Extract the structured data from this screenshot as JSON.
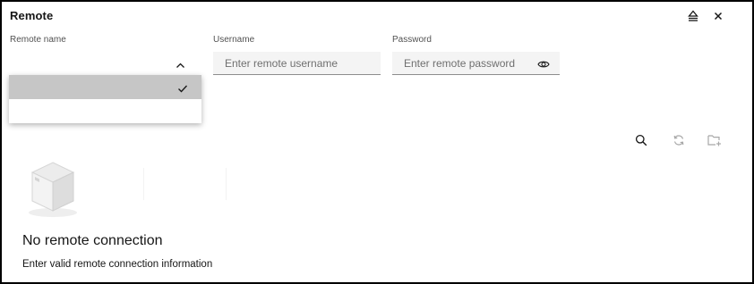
{
  "window": {
    "title": "Remote"
  },
  "header_icons": {
    "left": "eject-icon",
    "right": "close-icon"
  },
  "form": {
    "remote_name": {
      "label": "Remote name",
      "value": "",
      "options": [
        "",
        ""
      ],
      "selected_index": 0
    },
    "username": {
      "label": "Username",
      "placeholder": "Enter remote username"
    },
    "password": {
      "label": "Password",
      "placeholder": "Enter remote password"
    }
  },
  "toolbar": {
    "icons": [
      "search-icon",
      "refresh-icon",
      "new-folder-icon"
    ]
  },
  "empty_state": {
    "title": "No remote connection",
    "description": "Enter valid remote connection information"
  },
  "colors": {
    "selected_option": "#c6c6c6",
    "field_background": "#f4f4f4",
    "field_border": "#8d8d8d",
    "icon": "#161616",
    "disabled_icon": "#a8a8a8"
  }
}
